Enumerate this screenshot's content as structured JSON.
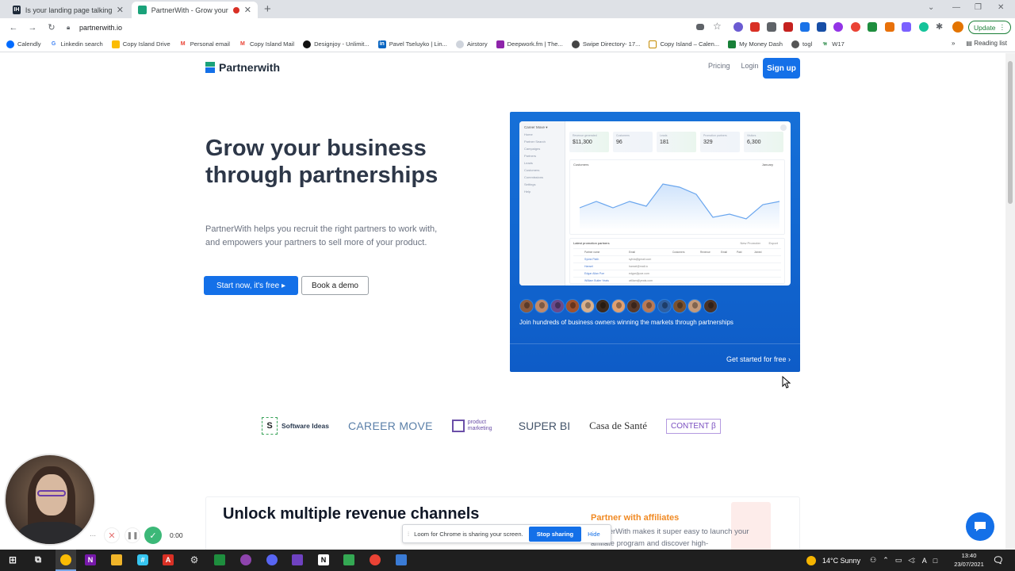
{
  "browser": {
    "tabs": [
      {
        "title": "Is your landing page talking to th",
        "favicon": "IH",
        "active": false
      },
      {
        "title": "PartnerWith - Grow your bu",
        "favicon": "partnerwith-logo",
        "active": true
      }
    ],
    "url": "partnerwith.io",
    "update_label": "Update",
    "bookmarks": [
      "Calendly",
      "Linkedin search",
      "Copy Island Drive",
      "Personal email",
      "Copy Island Mail",
      "Designjoy - Unlimit...",
      "Pavel Tseluyko | Lin...",
      "Airstory",
      "Deepwork.fm | The...",
      "Swipe Directory- 17...",
      "Copy Island – Calen...",
      "My Money Dash",
      "togl",
      "W17"
    ],
    "reading_list": "Reading list"
  },
  "site": {
    "logo_text": "Partnerwith",
    "nav": {
      "pricing": "Pricing",
      "login": "Login",
      "signup": "Sign up"
    },
    "hero": {
      "title": "Grow your business through partnerships",
      "subtitle": "PartnerWith helps you recruit the right partners to work with, and empowers your partners to sell more of your product.",
      "cta_primary": "Start now, it's free ▸",
      "cta_secondary": "Book a demo"
    },
    "card": {
      "join_text": "Join hundreds of business owners winning the markets through partnerships",
      "cta": "Get started for free ›",
      "dashboard": {
        "org": "Career Move ▾",
        "menu": [
          "Home",
          "Partner Search",
          "Campaigns",
          "Partners",
          "Leads",
          "Customers",
          "Commissions",
          "Settings",
          "Help"
        ],
        "stats": [
          {
            "label": "Revenue generated",
            "value": "$11,300"
          },
          {
            "label": "Customers",
            "value": "96"
          },
          {
            "label": "Leads",
            "value": "181"
          },
          {
            "label": "Promotion partners",
            "value": "329"
          },
          {
            "label": "Visitors",
            "value": "6,300"
          }
        ],
        "chart_title": "Customers",
        "chart_period": "January",
        "table_title": "Latest promotion partners",
        "table_actions": [
          "New Promoter",
          "Export"
        ],
        "table_columns": [
          "Partner name",
          "Email",
          "Customers",
          "Revenue",
          "Email",
          "Paid",
          "Joined"
        ],
        "table_rows": [
          {
            "name": "Sylvia Plath",
            "email": "sylvia@gmail.com"
          },
          {
            "name": "Hansel",
            "email": "hansel@mail.io"
          },
          {
            "name": "Edgar Allan Poe",
            "email": "edgar@poe.com"
          },
          {
            "name": "William Butler Yeats",
            "email": "william@yeats.com"
          }
        ]
      },
      "avatar_count": 13
    },
    "brands": [
      "Software Ideas",
      "CAREER MOVE",
      "product marketing",
      "SUPER BI",
      "Casa de Santé",
      "CONTENT β"
    ],
    "section": {
      "title": "Unlock multiple revenue channels",
      "feature_title": "Partner with affiliates",
      "feature_body": "PartnerWith makes it super easy to launch your affiliate program and discover high-"
    }
  },
  "loom": {
    "sharing_text": "Loom for Chrome is sharing your screen.",
    "stop_label": "Stop sharing",
    "hide_label": "Hide",
    "timer": "0:00"
  },
  "taskbar": {
    "weather": "14°C  Sunny",
    "time": "13:40",
    "date": "23/07/2021"
  },
  "colors": {
    "brand_blue": "#1470e8",
    "hero_text": "#2d3748",
    "affiliate_orange": "#f08a24"
  }
}
